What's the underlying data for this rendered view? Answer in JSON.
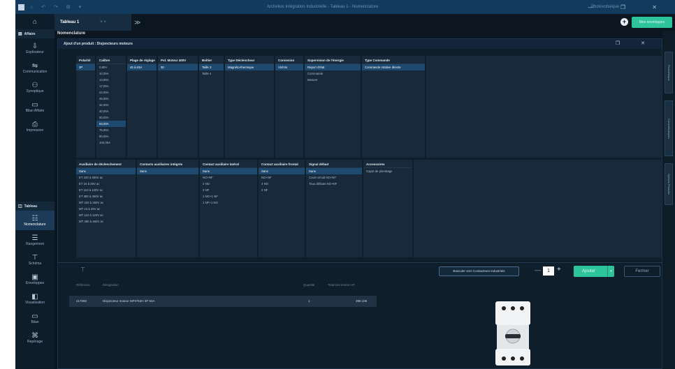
{
  "window": {
    "title": "Archelios Intégration Industrielle - Tableau 1 - Nomenclature",
    "user": "Photovoltaïque",
    "controls": "—  ❐  ✕",
    "quick_access": "⌂ ↶ ↷ ⊞ ▾"
  },
  "sidebar": {
    "top": [
      {
        "label": "Affaire",
        "icon": "home-icon"
      }
    ],
    "section_affaire": "Affaire",
    "affaire_items": [
      {
        "label": "Explorateur",
        "icon": "explorer-icon"
      },
      {
        "label": "Communication",
        "icon": "communication-icon"
      },
      {
        "label": "Synoptique",
        "icon": "synoptic-icon"
      },
      {
        "label": "Bilan Affaire",
        "icon": "report-icon"
      },
      {
        "label": "Impression",
        "icon": "print-icon"
      }
    ],
    "section_tableau": "Tableau",
    "tableau_items": [
      {
        "label": "Nomenclature",
        "icon": "list-icon",
        "active": true
      },
      {
        "label": "Rangement",
        "icon": "tidy-icon"
      },
      {
        "label": "Schéma",
        "icon": "schema-icon"
      },
      {
        "label": "Enveloppes",
        "icon": "enclosure-icon"
      },
      {
        "label": "Visualisation",
        "icon": "view-icon"
      },
      {
        "label": "Bilan",
        "icon": "report-icon"
      },
      {
        "label": "Repérage",
        "icon": "tag-icon"
      }
    ]
  },
  "tabs": {
    "active": "Tableau 1",
    "close": "˅ ×",
    "more": "≫"
  },
  "header": {
    "add_icon": "+",
    "envelope_button": "Mes enveloppes"
  },
  "page": {
    "title": "Nomenclature"
  },
  "dialog": {
    "title": "Ajout d'un produit : Disjoncteurs moteurs",
    "window_buttons": "❐ ✕",
    "section1": [
      {
        "header": "Polarité",
        "values": [
          "3P"
        ],
        "selected": 0,
        "width": 27
      },
      {
        "header": "Calibre",
        "values": [
          "0,80A",
          "10,00A",
          "13,00A",
          "17,00A",
          "22,00A",
          "26,00A",
          "32,00A",
          "40,00A",
          "50,00A",
          "63,00A",
          "75,00A",
          "90,00A",
          "100,00A"
        ],
        "selected": 9,
        "width": 42
      },
      {
        "header": "Plage de réglage",
        "values": [
          "45 à 63A"
        ],
        "selected": 0,
        "width": 42
      },
      {
        "header": "Pol. Moteur 400V",
        "values": [
          "30"
        ],
        "selected": 0,
        "width": 57
      },
      {
        "header": "Boîtier",
        "values": [
          "Taille 3",
          "Taille 4"
        ],
        "selected": 0,
        "width": 35
      },
      {
        "header": "Type Déclencheur",
        "values": [
          "Magnéto-thermique"
        ],
        "selected": 0,
        "width": 70
      },
      {
        "header": "Connexion",
        "values": [
          "Vis/Vis"
        ],
        "selected": 0,
        "width": 40
      },
      {
        "header": "Supervision de l'énergie",
        "values": [
          "Report d'état",
          "Commande",
          "Mesure"
        ],
        "selected": 0,
        "width": 80
      },
      {
        "header": "Type Commande",
        "values": [
          "Commande rotative directe"
        ],
        "selected": 0,
        "width": 90
      }
    ],
    "section2": [
      {
        "header": "Auxiliaire de déclenchement",
        "values": [
          "Sans",
          "ET 220 à 260V ac",
          "ET 24 à 29V ac",
          "ET 110 à 120V ac",
          "ET 380 à 460V ac",
          "MT 220 à 260V ac",
          "MT 24 à 29V ac",
          "MT 110 à 120V ac",
          "MT 380 à 460V ac"
        ],
        "selected": 0,
        "width": 85
      },
      {
        "header": "Contacts auxiliaires intégrés",
        "values": [
          "Sans"
        ],
        "selected": 0,
        "width": 88
      },
      {
        "header": "Contact auxiliaire latéral",
        "values": [
          "Sans",
          "NO+NF",
          "2 NO",
          "2 NF",
          "1 NO+1 NF",
          "1 NF+1 NO"
        ],
        "selected": 0,
        "width": 82
      },
      {
        "header": "Contact auxiliaire frontal",
        "values": [
          "Sans",
          "NO+NF",
          "2 NO",
          "2 NF"
        ],
        "selected": 0,
        "width": 66
      },
      {
        "header": "Signal défaut",
        "values": [
          "Sans",
          "Court-circuit NO+NF",
          "Tous défauts NO+NF"
        ],
        "selected": 0,
        "width": 80
      },
      {
        "header": "Accessoires",
        "values": [
          "Capot de plombage"
        ],
        "selected": -1,
        "width": 70
      }
    ],
    "filter_icon": "⊤",
    "revert_button": "Basculer vers Contacteurs industriels",
    "quantity": "1",
    "minus": "—",
    "plus": "+",
    "add_button": "Ajouter",
    "close_button": "Fermer",
    "table": {
      "headers": {
        "ref": "Référence",
        "designation": "Désignation",
        "qty": "Quantité",
        "total": "Total brut remisé HT"
      },
      "row": {
        "ref": "417060",
        "designation": "Disjoncteur moteur MPX³63H 3P 63A",
        "qty": "1",
        "total": "398.10€"
      }
    }
  },
  "right_panel_tabs": [
    "Photothèque",
    "Caractéristiques",
    "Options Produits"
  ],
  "colors": {
    "accent": "#2dc39b",
    "selected": "#1e4a70",
    "titlebar": "#123a5c"
  }
}
